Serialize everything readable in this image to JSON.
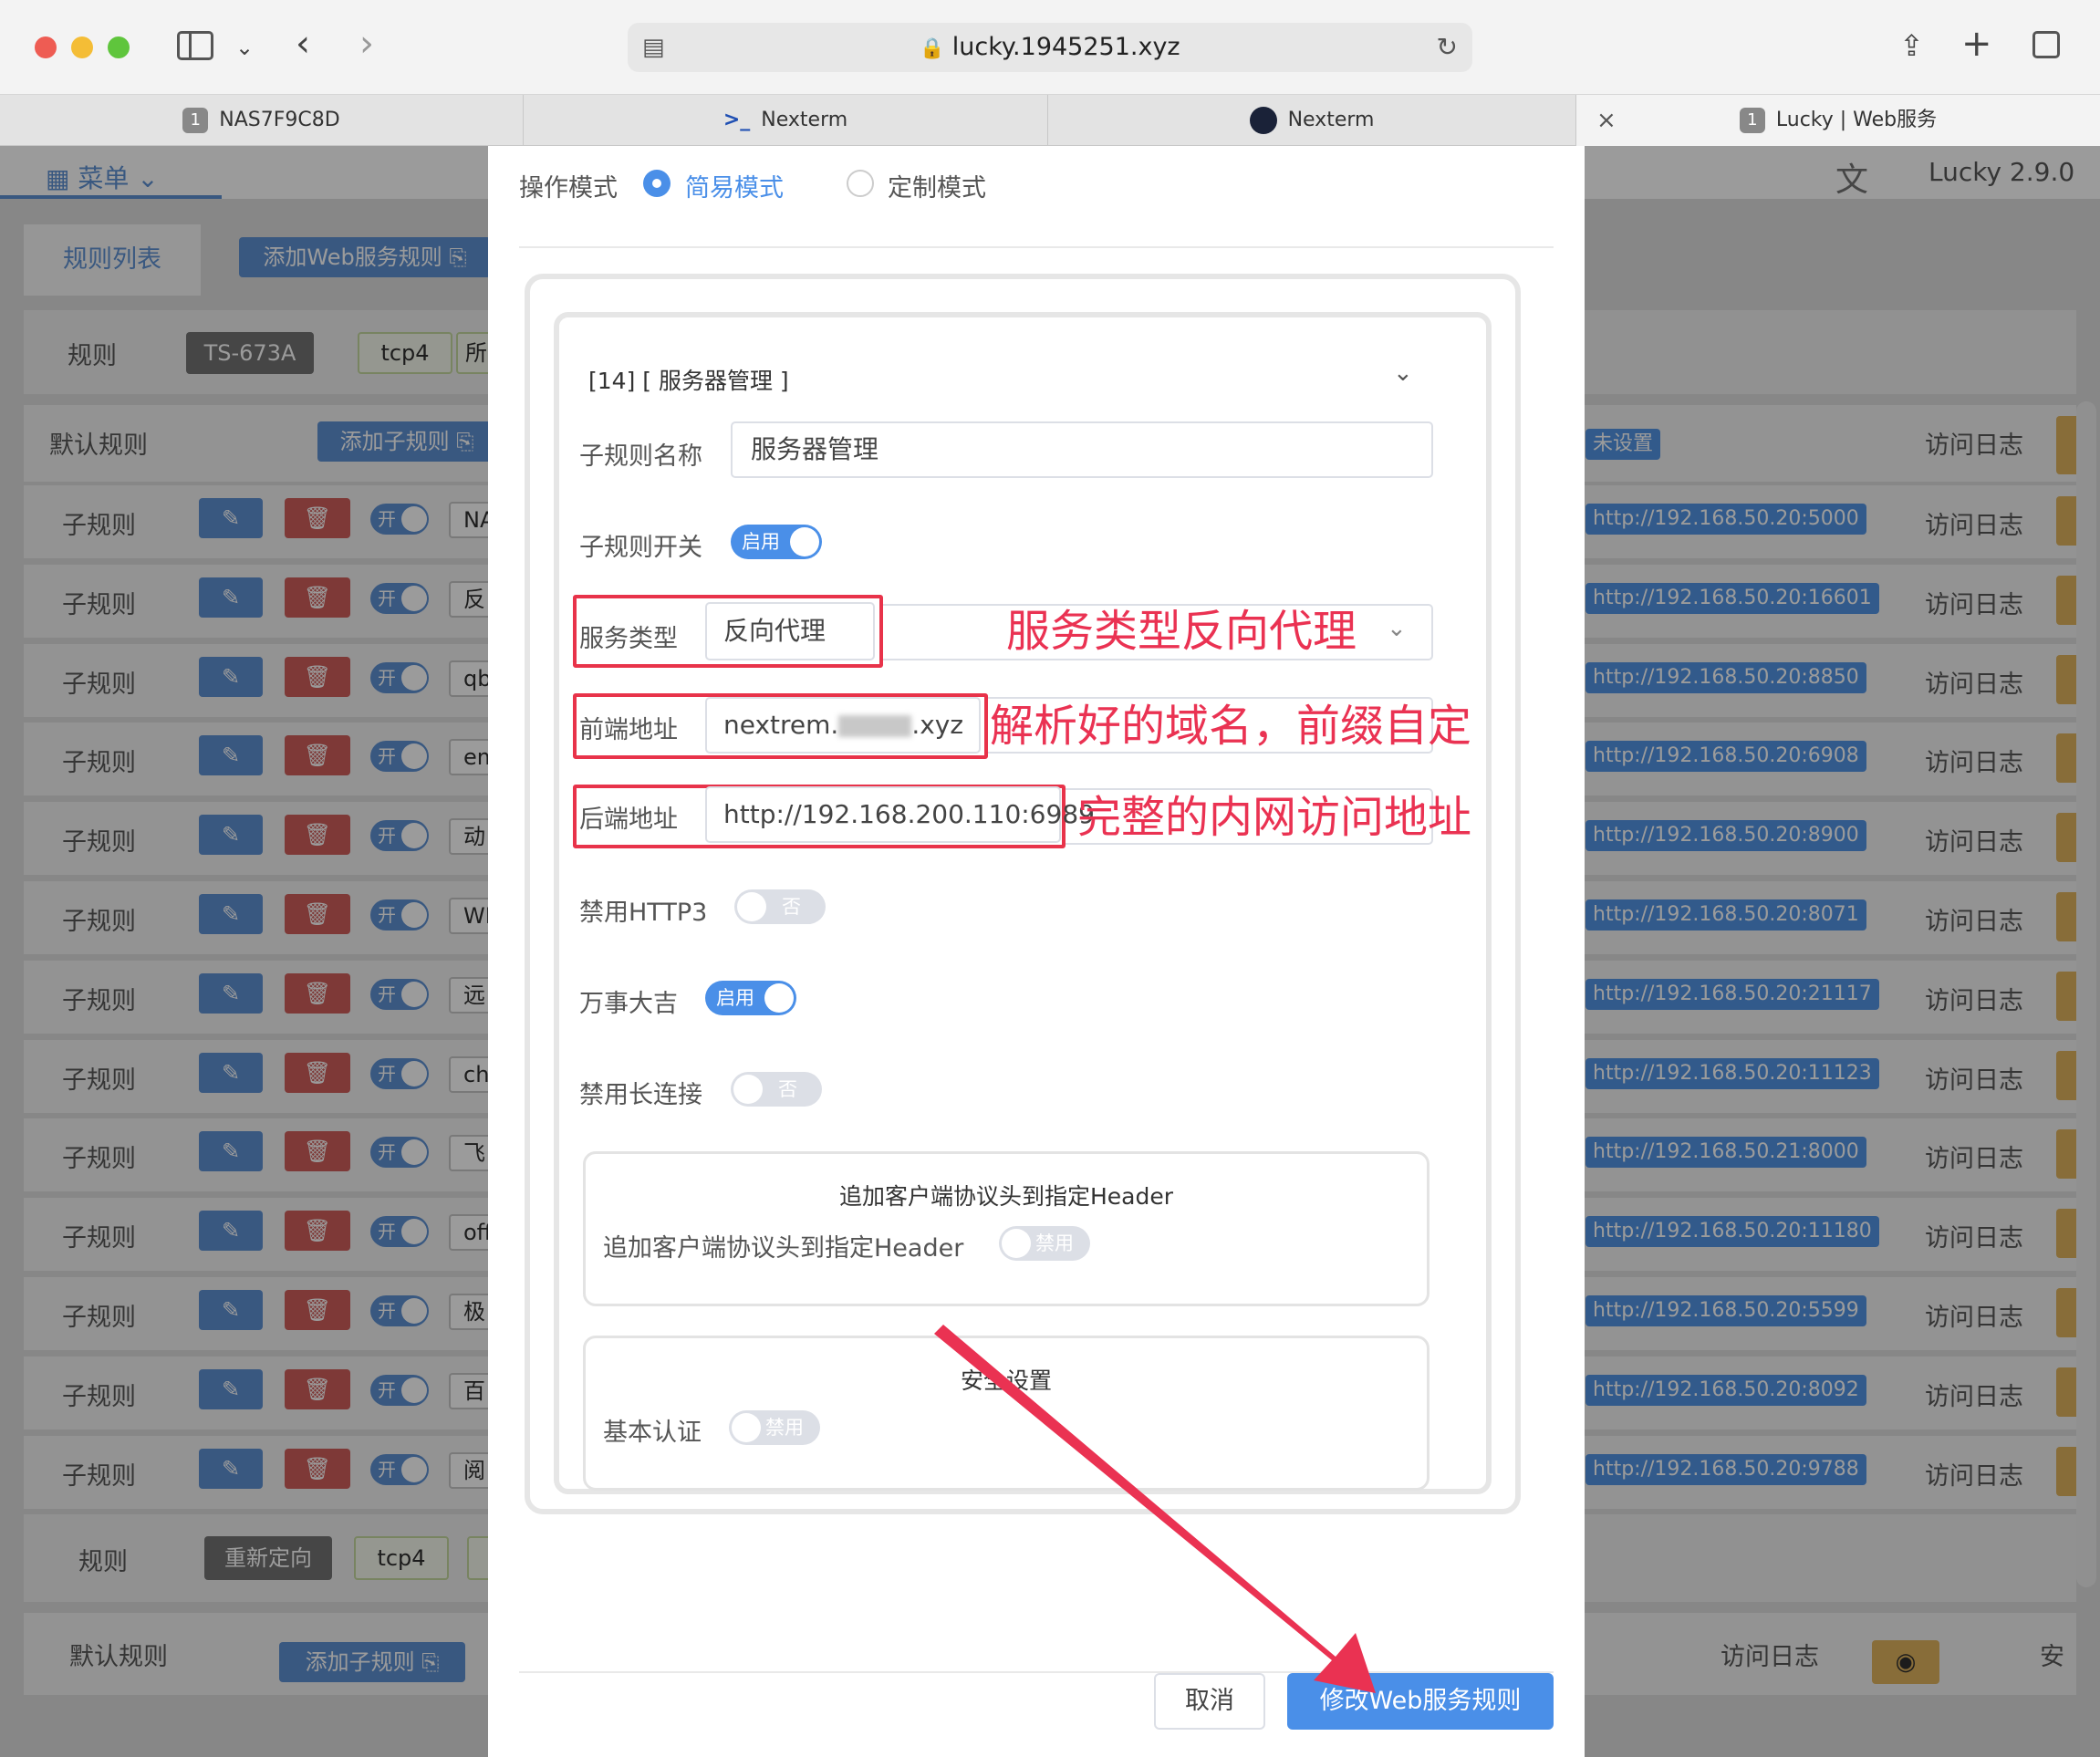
{
  "browser": {
    "url": "lucky.1945251.xyz",
    "tabs": [
      {
        "badge": "1",
        "label": "NAS7F9C8D"
      },
      {
        "label": "Nexterm"
      },
      {
        "label": "Nexterm"
      },
      {
        "badge": "1",
        "label": "Lucky | Web服务"
      }
    ]
  },
  "app": {
    "menu_label": "菜单",
    "version": "Lucky 2.9.0",
    "tabs": {
      "rules_list": "规则列表",
      "add_rule": "添加Web服务规则"
    },
    "rule1": {
      "label": "规则",
      "name": "TS-673A",
      "proto": "tcp4",
      "extra": "所"
    },
    "default_rule": {
      "label": "默认规则",
      "add_sub": "添加子规则",
      "unset": "未设置",
      "log": "访问日志"
    },
    "sub_rules": [
      {
        "label": "子规则",
        "toggle": "开",
        "name": "NA",
        "target": "http://192.168.50.20:5000",
        "log": "访问日志"
      },
      {
        "label": "子规则",
        "toggle": "开",
        "name": "反",
        "target": "http://192.168.50.20:16601",
        "log": "访问日志"
      },
      {
        "label": "子规则",
        "toggle": "开",
        "name": "qb",
        "target": "http://192.168.50.20:8850",
        "log": "访问日志"
      },
      {
        "label": "子规则",
        "toggle": "开",
        "name": "em",
        "target": "http://192.168.50.20:6908",
        "log": "访问日志"
      },
      {
        "label": "子规则",
        "toggle": "开",
        "name": "动",
        "target": "http://192.168.50.20:8900",
        "log": "访问日志"
      },
      {
        "label": "子规则",
        "toggle": "开",
        "name": "WE",
        "target": "http://192.168.50.20:8071",
        "log": "访问日志"
      },
      {
        "label": "子规则",
        "toggle": "开",
        "name": "远",
        "target": "http://192.168.50.20:21117",
        "log": "访问日志"
      },
      {
        "label": "子规则",
        "toggle": "开",
        "name": "ch",
        "target": "http://192.168.50.20:11123",
        "log": "访问日志"
      },
      {
        "label": "子规则",
        "toggle": "开",
        "name": "飞",
        "target": "http://192.168.50.21:8000",
        "log": "访问日志"
      },
      {
        "label": "子规则",
        "toggle": "开",
        "name": "off",
        "target": "http://192.168.50.20:11180",
        "log": "访问日志"
      },
      {
        "label": "子规则",
        "toggle": "开",
        "name": "极",
        "target": "http://192.168.50.20:5599",
        "log": "访问日志"
      },
      {
        "label": "子规则",
        "toggle": "开",
        "name": "百",
        "target": "http://192.168.50.20:8092",
        "log": "访问日志"
      },
      {
        "label": "子规则",
        "toggle": "开",
        "name": "阅",
        "target": "http://192.168.50.20:9788",
        "log": "访问日志"
      }
    ],
    "rule2": {
      "label": "规则",
      "name": "重新定向",
      "proto": "tcp4",
      "extra": "所"
    },
    "default_rule2": {
      "label": "默认规则",
      "add_sub": "添加子规则",
      "log": "访问日志",
      "extra": "安"
    }
  },
  "modal": {
    "mode_label": "操作模式",
    "mode_simple": "简易模式",
    "mode_custom": "定制模式",
    "section_title": "[14] [ 服务器管理 ]",
    "sub_name_label": "子规则名称",
    "sub_name_value": "服务器管理",
    "switch_label": "子规则开关",
    "switch_on": "启用",
    "service_type_label": "服务类型",
    "service_type_value": "反向代理",
    "frontend_label": "前端地址",
    "frontend_value": "nextrem.",
    "frontend_suffix": ".xyz",
    "backend_label": "后端地址",
    "backend_value": "http://192.168.200.110:6989",
    "http3_label": "禁用HTTP3",
    "http3_value": "否",
    "wanshi_label": "万事大吉",
    "wanshi_value": "启用",
    "keepalive_label": "禁用长连接",
    "keepalive_value": "否",
    "header_group_title": "追加客户端协议头到指定Header",
    "header_label": "追加客户端协议头到指定Header",
    "header_value": "禁用",
    "security_title": "安全设置",
    "basic_auth_label": "基本认证",
    "basic_auth_value": "禁用",
    "cancel": "取消",
    "submit": "修改Web服务规则"
  },
  "annotations": {
    "a1": "服务类型反向代理",
    "a2": "解析好的域名，前缀自定",
    "a3": "完整的内网访问地址"
  },
  "colors": {
    "primary": "#4a8fe8",
    "danger": "#ea3252",
    "edit": "#3b78c9",
    "delete": "#c43a36",
    "switch_off": "#dcdfe6"
  }
}
